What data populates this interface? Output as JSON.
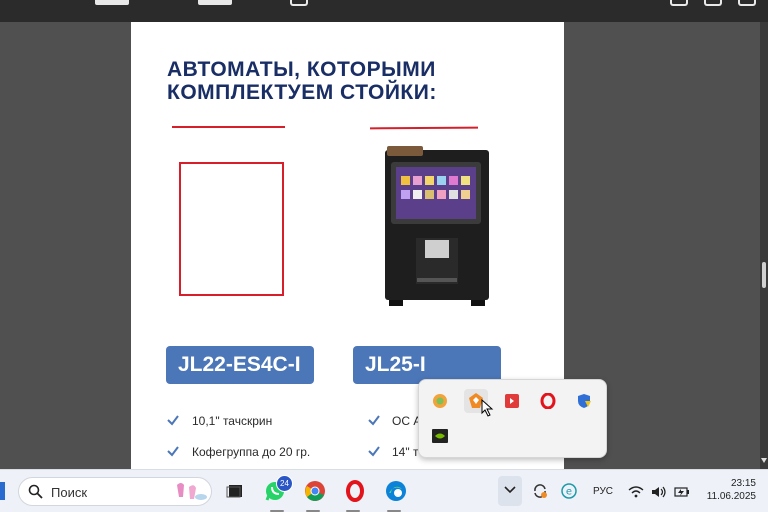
{
  "document": {
    "heading_line1": "АВТОМАТЫ, КОТОРЫМИ",
    "heading_line2": "КОМПЛЕКТУЕМ СТОЙКИ:",
    "models": [
      {
        "name": "JL22-ES4C-I",
        "features": [
          "10,1\" тачскрин",
          "Кофегруппа до 20 гр."
        ]
      },
      {
        "name": "JL25-I",
        "features": [
          "ОС А",
          "14\" т"
        ]
      }
    ],
    "colors": {
      "heading": "#1a2e66",
      "accent_red": "#d71f2c",
      "model_button": "#4b76b8"
    }
  },
  "tray_popup": {
    "icons": [
      "chrome-canary-icon",
      "app-orange-icon",
      "anydesk-icon",
      "opera-icon",
      "windows-security-icon",
      "nvidia-icon"
    ]
  },
  "taskbar": {
    "search_placeholder": "Поиск",
    "whatsapp_badge": "24",
    "language": "РУС",
    "time": "23:15",
    "date": "11.06.2025"
  }
}
